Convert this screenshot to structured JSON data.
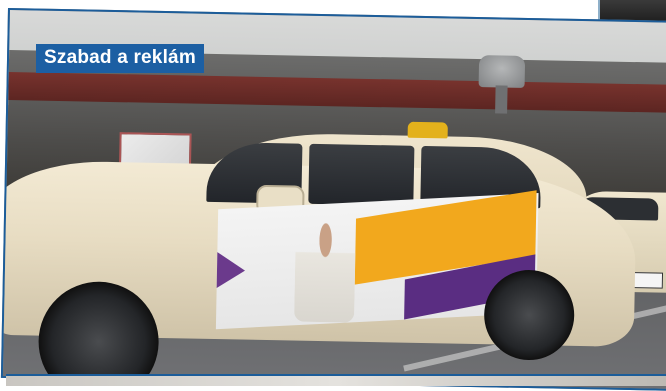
{
  "caption": {
    "label": "Szabad a reklám",
    "bg_color": "#1c5fa3",
    "text_color": "#ffffff"
  },
  "scene": {
    "frame_color": "#1c5d9a"
  }
}
